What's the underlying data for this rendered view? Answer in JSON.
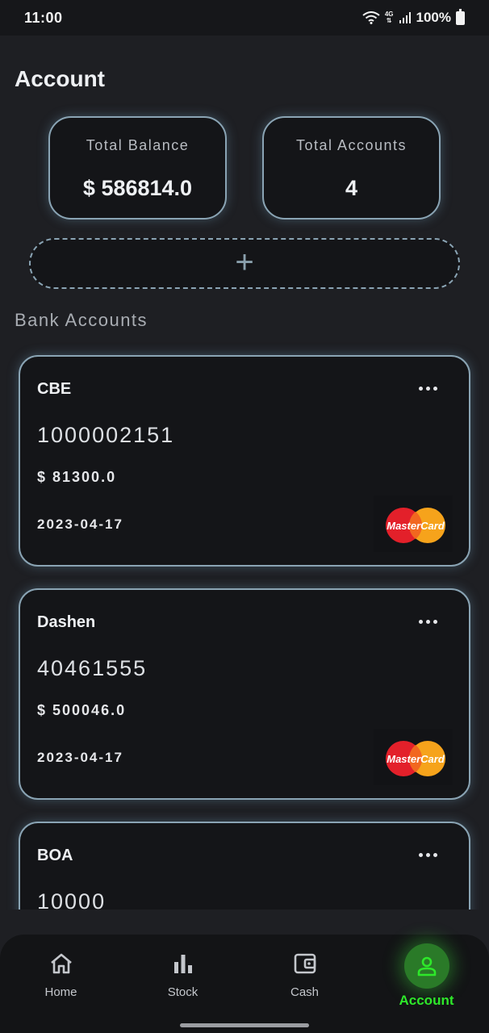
{
  "status_bar": {
    "time": "11:00",
    "network": "4G",
    "battery": "100%"
  },
  "page": {
    "title": "Account"
  },
  "summary": {
    "total_balance_label": "Total Balance",
    "total_balance_value": "$ 586814.0",
    "total_accounts_label": "Total Accounts",
    "total_accounts_value": "4"
  },
  "add_account": {
    "symbol": "+"
  },
  "section": {
    "title": "Bank Accounts"
  },
  "accounts": [
    {
      "bank": "CBE",
      "number": "1000002151",
      "balance": "$ 81300.0",
      "date": "2023-04-17",
      "card_brand": "MasterCard"
    },
    {
      "bank": "Dashen",
      "number": "40461555",
      "balance": "$ 500046.0",
      "date": "2023-04-17",
      "card_brand": "MasterCard"
    },
    {
      "bank": "BOA",
      "number": "10000"
    }
  ],
  "nav": {
    "items": [
      {
        "label": "Home",
        "icon": "home-icon"
      },
      {
        "label": "Stock",
        "icon": "bar-chart-icon"
      },
      {
        "label": "Cash",
        "icon": "wallet-icon"
      },
      {
        "label": "Account",
        "icon": "person-icon",
        "active": true
      }
    ]
  },
  "colors": {
    "accent": "#2ee82a",
    "card_border": "#8aa4b4",
    "background": "#1e1f23"
  }
}
